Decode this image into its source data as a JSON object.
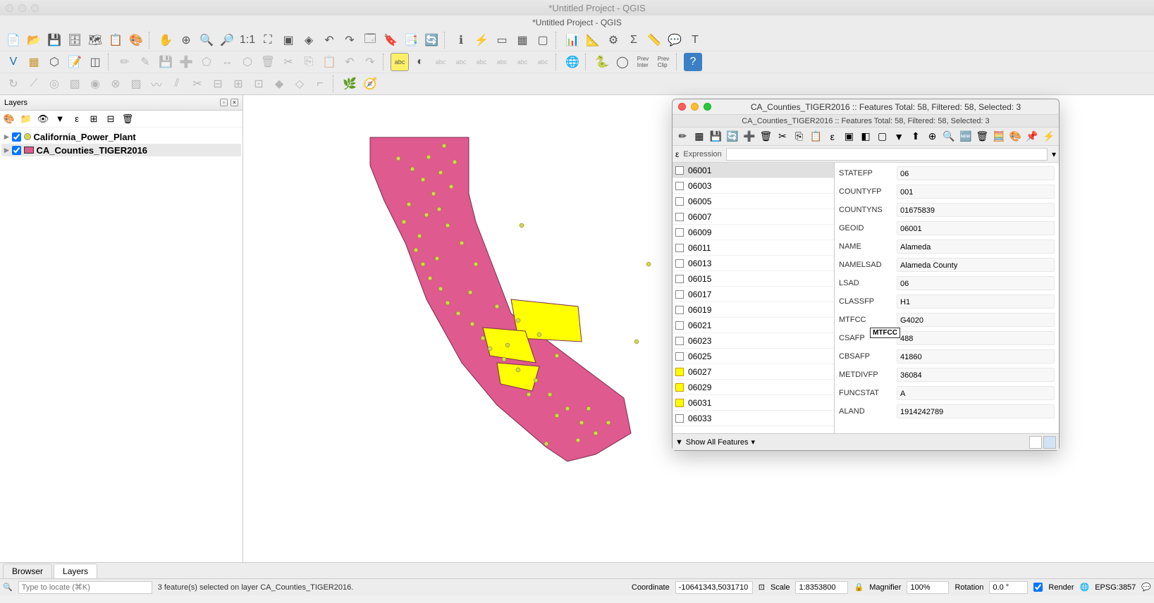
{
  "window": {
    "mac_title": "*Untitled Project - QGIS",
    "doc_title": "*Untitled Project - QGIS"
  },
  "layers_panel": {
    "title": "Layers",
    "items": [
      {
        "name": "California_Power_Plant",
        "checked": true,
        "type": "point"
      },
      {
        "name": "CA_Counties_TIGER2016",
        "checked": true,
        "type": "poly",
        "active": true
      }
    ]
  },
  "tabs": {
    "browser": "Browser",
    "layers": "Layers"
  },
  "statusbar": {
    "locate_placeholder": "Type to locate (⌘K)",
    "message": "3 feature(s) selected on layer CA_Counties_TIGER2016.",
    "coord_label": "Coordinate",
    "coord_value": "-10641343,5031710",
    "scale_label": "Scale",
    "scale_value": "1:8353800",
    "magnifier_label": "Magnifier",
    "magnifier_value": "100%",
    "rotation_label": "Rotation",
    "rotation_value": "0.0 °",
    "render_label": "Render",
    "crs": "EPSG:3857"
  },
  "attr_table": {
    "title": "CA_Counties_TIGER2016 :: Features Total: 58, Filtered: 58, Selected: 3",
    "subtitle": "CA_Counties_TIGER2016 :: Features Total: 58, Filtered: 58, Selected: 3",
    "expression_label": "Expression",
    "rows": [
      {
        "id": "06001",
        "selected": false,
        "active": true
      },
      {
        "id": "06003",
        "selected": false
      },
      {
        "id": "06005",
        "selected": false
      },
      {
        "id": "06007",
        "selected": false
      },
      {
        "id": "06009",
        "selected": false
      },
      {
        "id": "06011",
        "selected": false
      },
      {
        "id": "06013",
        "selected": false
      },
      {
        "id": "06015",
        "selected": false
      },
      {
        "id": "06017",
        "selected": false
      },
      {
        "id": "06019",
        "selected": false
      },
      {
        "id": "06021",
        "selected": false
      },
      {
        "id": "06023",
        "selected": false
      },
      {
        "id": "06025",
        "selected": false
      },
      {
        "id": "06027",
        "selected": true
      },
      {
        "id": "06029",
        "selected": true
      },
      {
        "id": "06031",
        "selected": true
      },
      {
        "id": "06033",
        "selected": false
      }
    ],
    "fields": [
      {
        "label": "STATEFP",
        "value": "06"
      },
      {
        "label": "COUNTYFP",
        "value": "001"
      },
      {
        "label": "COUNTYNS",
        "value": "01675839"
      },
      {
        "label": "GEOID",
        "value": "06001"
      },
      {
        "label": "NAME",
        "value": "Alameda"
      },
      {
        "label": "NAMELSAD",
        "value": "Alameda County"
      },
      {
        "label": "LSAD",
        "value": "06"
      },
      {
        "label": "CLASSFP",
        "value": "H1"
      },
      {
        "label": "MTFCC",
        "value": "G4020"
      },
      {
        "label": "CSAFP",
        "value": "488"
      },
      {
        "label": "CBSAFP",
        "value": "41860"
      },
      {
        "label": "METDIVFP",
        "value": "36084"
      },
      {
        "label": "FUNCSTAT",
        "value": "A"
      },
      {
        "label": "ALAND",
        "value": "1914242789"
      }
    ],
    "tooltip": "MTFCC",
    "footer_btn": "Show All Features"
  }
}
